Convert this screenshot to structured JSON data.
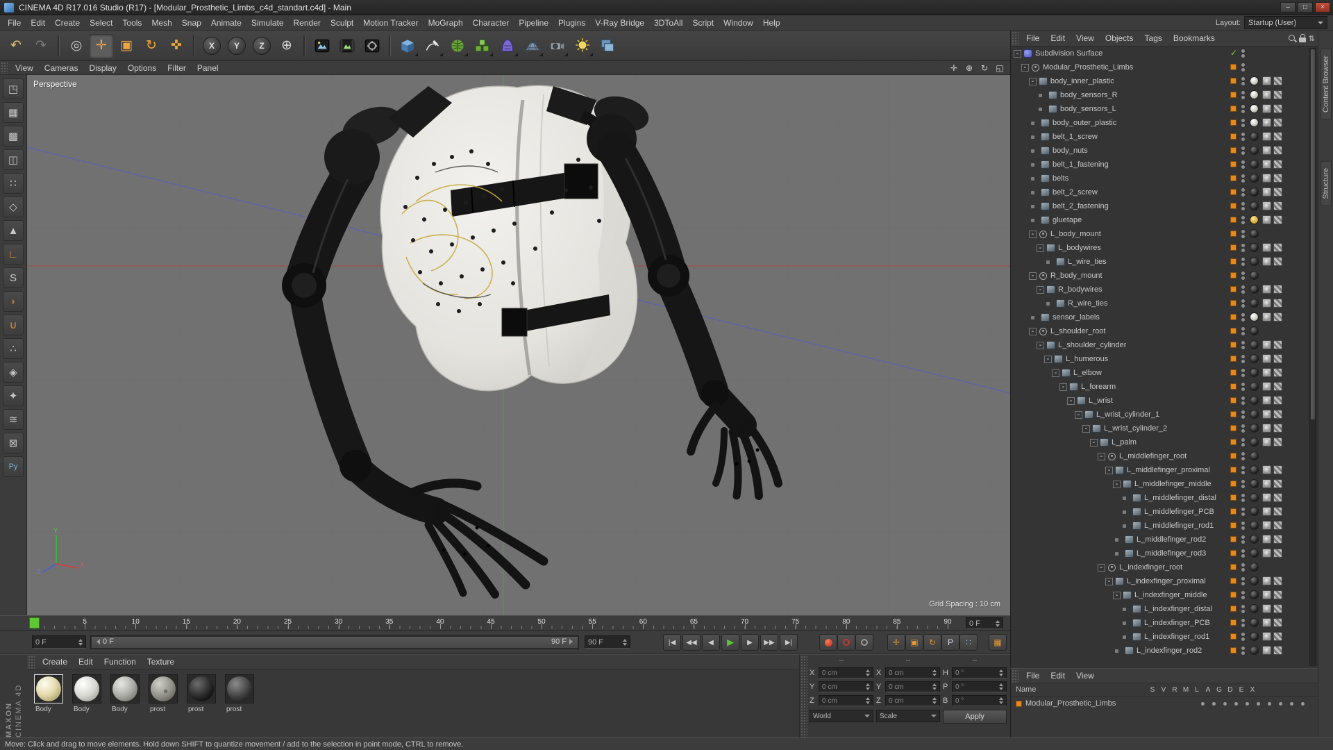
{
  "window": {
    "title": "CINEMA 4D R17.016 Studio (R17) - [Modular_Prosthetic_Limbs_c4d_standart.c4d] - Main",
    "minimize_label": "–",
    "maximize_label": "□",
    "close_label": "×"
  },
  "menubar": {
    "items": [
      "File",
      "Edit",
      "Create",
      "Select",
      "Tools",
      "Mesh",
      "Snap",
      "Animate",
      "Simulate",
      "Render",
      "Sculpt",
      "Motion Tracker",
      "MoGraph",
      "Character",
      "Pipeline",
      "Plugins",
      "V-Ray Bridge",
      "3DToAll",
      "Script",
      "Window",
      "Help"
    ],
    "layout_label": "Layout:",
    "layout_value": "Startup (User)"
  },
  "toolbar": {
    "buttons": [
      {
        "name": "undo-button",
        "kind": "glyph",
        "glyph": "↶",
        "color": "#e0be6a"
      },
      {
        "name": "redo-button",
        "kind": "glyph",
        "glyph": "↷",
        "color": "#7a7a7a"
      },
      {
        "kind": "sep"
      },
      {
        "name": "live-selection-button",
        "kind": "glyph",
        "glyph": "◎",
        "color": "#cccccc"
      },
      {
        "name": "move-tool-button",
        "kind": "glyph",
        "glyph": "✛",
        "color": "#f0a43c",
        "active": true
      },
      {
        "name": "scale-tool-button",
        "kind": "glyph",
        "glyph": "▣",
        "color": "#f0a43c"
      },
      {
        "name": "rotate-tool-button",
        "kind": "glyph",
        "glyph": "↻",
        "color": "#f0a43c"
      },
      {
        "name": "last-used-tool-button",
        "kind": "glyph",
        "glyph": "✜",
        "color": "#f0a43c"
      },
      {
        "kind": "sep"
      },
      {
        "name": "lock-x-axis-button",
        "kind": "circle",
        "letter": "X"
      },
      {
        "name": "lock-y-axis-button",
        "kind": "circle",
        "letter": "Y"
      },
      {
        "name": "lock-z-axis-button",
        "kind": "circle",
        "letter": "Z"
      },
      {
        "name": "coordinate-system-button",
        "kind": "glyph",
        "glyph": "⊕",
        "color": "#d8d8d8"
      },
      {
        "kind": "sep"
      },
      {
        "name": "render-view-button",
        "kind": "sym",
        "sym": "sym-render"
      },
      {
        "name": "render-to-picture-viewer-button",
        "kind": "sym",
        "sym": "sym-render-pv"
      },
      {
        "name": "edit-render-settings-button",
        "kind": "sym",
        "sym": "sym-render-settings"
      },
      {
        "kind": "sep"
      },
      {
        "name": "add-cube-button",
        "kind": "sym",
        "sym": "sym-cube",
        "flyout": true
      },
      {
        "name": "freehand-spline-button",
        "kind": "sym",
        "sym": "sym-pen",
        "flyout": true
      },
      {
        "name": "add-subdivision-surface-button",
        "kind": "sym",
        "sym": "sym-cage",
        "flyout": true
      },
      {
        "name": "add-mograph-cloner-button",
        "kind": "sym",
        "sym": "sym-array",
        "flyout": true
      },
      {
        "name": "add-deformer-button",
        "kind": "sym",
        "sym": "sym-deformer",
        "flyout": true
      },
      {
        "name": "add-floor-button",
        "kind": "sym",
        "sym": "sym-floor",
        "flyout": true
      },
      {
        "name": "add-camera-button",
        "kind": "sym",
        "sym": "sym-camera",
        "flyout": true
      },
      {
        "name": "add-light-button",
        "kind": "sym",
        "sym": "sym-light",
        "flyout": true
      },
      {
        "name": "interactive-render-region-button",
        "kind": "sym",
        "sym": "sym-irr"
      }
    ]
  },
  "left_palette": {
    "buttons": [
      {
        "name": "make-editable-button",
        "glyph": "◳",
        "color": "#c8c8c8"
      },
      {
        "name": "model-mode-button",
        "glyph": "▦",
        "color": "#c8c8c8"
      },
      {
        "name": "texture-mode-button",
        "glyph": "▩",
        "color": "#c8c8c8"
      },
      {
        "name": "workplane-mode-button",
        "glyph": "◫",
        "color": "#c8c8c8"
      },
      {
        "name": "points-mode-button",
        "glyph": "∷",
        "color": "#c8c8c8"
      },
      {
        "name": "edges-mode-button",
        "glyph": "◇",
        "color": "#c8c8c8"
      },
      {
        "name": "polygons-mode-button",
        "glyph": "▲",
        "color": "#c8c8c8"
      },
      {
        "name": "enable-axis-button",
        "glyph": "∟",
        "color": "#e8962e"
      },
      {
        "name": "viewport-solo-button",
        "glyph": "S",
        "color": "#c8c8c8"
      },
      {
        "name": "sculpt-brush-button",
        "glyph": "◗",
        "color": "#b07840"
      },
      {
        "name": "snap-toggle-button",
        "glyph": "∪",
        "color": "#e8962e"
      },
      {
        "name": "quantize-button",
        "glyph": "∴",
        "color": "#c8c8c8"
      },
      {
        "name": "workplane-lock-button",
        "glyph": "◈",
        "color": "#c8c8c8"
      },
      {
        "name": "tweak-mode-button",
        "glyph": "✦",
        "color": "#c8c8c8"
      },
      {
        "name": "isoline-editing-button",
        "glyph": "≋",
        "color": "#c8c8c8"
      },
      {
        "name": "lock-button",
        "glyph": "⊠",
        "color": "#c8c8c8"
      },
      {
        "name": "python-button",
        "glyph": "Py",
        "color": "#7ab0d4"
      }
    ]
  },
  "viewport": {
    "menus": [
      "View",
      "Cameras",
      "Display",
      "Options",
      "Filter",
      "Panel"
    ],
    "corner_icons": [
      {
        "name": "camera-move-icon",
        "glyph": "✛"
      },
      {
        "name": "camera-zoom-icon",
        "glyph": "⊕"
      },
      {
        "name": "camera-rotate-icon",
        "glyph": "↻"
      },
      {
        "name": "toggle-view-icon",
        "glyph": "◱"
      }
    ],
    "view_label": "Perspective",
    "grid_spacing_label": "Grid Spacing : 10 cm",
    "axis_labels": [
      "X",
      "Y",
      "Z"
    ]
  },
  "timeline": {
    "frame_labels": [
      "5",
      "10",
      "15",
      "20",
      "25",
      "30",
      "35",
      "40",
      "45",
      "50",
      "55",
      "60",
      "65",
      "70",
      "75",
      "80",
      "85",
      "90"
    ],
    "frame_start": 0,
    "frame_end": 90,
    "current_frame": 0,
    "ruler_field": "0 F",
    "current_frame_field": "0 F",
    "range_start_label": "0 F",
    "range_end_label": "90 F",
    "end_frame_field": "90 F",
    "transport": [
      {
        "name": "go-to-start-button",
        "label": "|◀"
      },
      {
        "name": "go-to-previous-key-button",
        "label": "◀◀"
      },
      {
        "name": "go-to-previous-frame-button",
        "label": "◀"
      },
      {
        "name": "play-forwards-button",
        "label": "▶",
        "accent": true
      },
      {
        "name": "go-to-next-frame-button",
        "label": "▶"
      },
      {
        "name": "go-to-next-key-button",
        "label": "▶▶"
      },
      {
        "name": "go-to-end-button",
        "label": "▶|"
      }
    ],
    "record_buttons": [
      {
        "name": "record-keyframe-button",
        "kind": "red-dot"
      },
      {
        "name": "autokeying-button",
        "kind": "red-ring"
      },
      {
        "name": "keyframe-selection-button",
        "kind": "gray-dot"
      }
    ],
    "record_toggles": [
      {
        "name": "record-position-toggle",
        "glyph": "✛",
        "color": "#e8962e"
      },
      {
        "name": "record-scale-toggle",
        "glyph": "▣",
        "color": "#e8962e"
      },
      {
        "name": "record-rotation-toggle",
        "glyph": "↻",
        "color": "#e8962e"
      },
      {
        "name": "record-parameter-toggle",
        "glyph": "P",
        "color": "#d8dce8"
      },
      {
        "name": "point-level-animation-toggle",
        "glyph": "∷",
        "color": "#9fb8d8"
      }
    ],
    "options_glyph": "▦"
  },
  "materials_panel": {
    "menus": [
      "Create",
      "Edit",
      "Function",
      "Texture"
    ],
    "materials": [
      {
        "name": "Body",
        "look": "ivory",
        "selected": true
      },
      {
        "name": "Body",
        "look": "white"
      },
      {
        "name": "Body",
        "look": "gray"
      },
      {
        "name": "prost",
        "look": "speckled"
      },
      {
        "name": "prost",
        "look": "black"
      },
      {
        "name": "prost",
        "look": "darkgray"
      }
    ]
  },
  "coordinates_panel": {
    "headers": [
      "--",
      "--",
      "--"
    ],
    "columns": [
      {
        "name": "position",
        "rows": [
          [
            "X",
            "0 cm"
          ],
          [
            "Y",
            "0 cm"
          ],
          [
            "Z",
            "0 cm"
          ]
        ],
        "footer_kind": "dropdown",
        "footer_label": "World"
      },
      {
        "name": "size",
        "rows": [
          [
            "X",
            "0 cm"
          ],
          [
            "Y",
            "0 cm"
          ],
          [
            "Z",
            "0 cm"
          ]
        ],
        "footer_kind": "dropdown",
        "footer_label": "Scale"
      },
      {
        "name": "rotation",
        "rows": [
          [
            "H",
            "0 °"
          ],
          [
            "P",
            "0 °"
          ],
          [
            "B",
            "0 °"
          ]
        ],
        "footer_kind": "button",
        "footer_label": "Apply"
      }
    ]
  },
  "object_manager": {
    "menus": [
      "File",
      "Edit",
      "View",
      "Objects",
      "Tags",
      "Bookmarks"
    ],
    "items": [
      {
        "n": "Subdivision Surface",
        "l": 0,
        "e": 1,
        "i": "sds",
        "m": null,
        "check": true
      },
      {
        "n": "Modular_Prosthetic_Limbs",
        "l": 1,
        "e": 1,
        "i": "null",
        "m": null
      },
      {
        "n": "body_inner_plastic",
        "l": 2,
        "e": 1,
        "i": "mesh",
        "m": "w"
      },
      {
        "n": "body_sensors_R",
        "l": 3,
        "i": "mesh",
        "m": "w"
      },
      {
        "n": "body_sensors_L",
        "l": 3,
        "i": "mesh",
        "m": "w"
      },
      {
        "n": "body_outer_plastic",
        "l": 2,
        "i": "mesh",
        "m": "w"
      },
      {
        "n": "belt_1_screw",
        "l": 2,
        "i": "mesh",
        "m": "d"
      },
      {
        "n": "body_nuts",
        "l": 2,
        "i": "mesh",
        "m": "d"
      },
      {
        "n": "belt_1_fastening",
        "l": 2,
        "i": "mesh",
        "m": "d"
      },
      {
        "n": "belts",
        "l": 2,
        "i": "mesh",
        "m": "d"
      },
      {
        "n": "belt_2_screw",
        "l": 2,
        "i": "mesh",
        "m": "d"
      },
      {
        "n": "belt_2_fastening",
        "l": 2,
        "i": "mesh",
        "m": "d"
      },
      {
        "n": "gluetape",
        "l": 2,
        "i": "mesh",
        "m": "y"
      },
      {
        "n": "L_body_mount",
        "l": 2,
        "e": 1,
        "i": "null",
        "m": "d"
      },
      {
        "n": "L_bodywires",
        "l": 3,
        "e": 1,
        "i": "mesh",
        "m": "d"
      },
      {
        "n": "L_wire_ties",
        "l": 4,
        "i": "mesh",
        "m": "d"
      },
      {
        "n": "R_body_mount",
        "l": 2,
        "e": 1,
        "i": "null",
        "m": "d"
      },
      {
        "n": "R_bodywires",
        "l": 3,
        "e": 1,
        "i": "mesh",
        "m": "d"
      },
      {
        "n": "R_wire_ties",
        "l": 4,
        "i": "mesh",
        "m": "d"
      },
      {
        "n": "sensor_labels",
        "l": 2,
        "i": "mesh",
        "m": "w"
      },
      {
        "n": "L_shoulder_root",
        "l": 2,
        "e": 1,
        "i": "null",
        "m": "d"
      },
      {
        "n": "L_shoulder_cylinder",
        "l": 3,
        "e": 1,
        "i": "mesh",
        "m": "d"
      },
      {
        "n": "L_humerous",
        "l": 4,
        "e": 1,
        "i": "mesh",
        "m": "d"
      },
      {
        "n": "L_elbow",
        "l": 5,
        "e": 1,
        "i": "mesh",
        "m": "d"
      },
      {
        "n": "L_forearm",
        "l": 6,
        "e": 1,
        "i": "mesh",
        "m": "d"
      },
      {
        "n": "L_wrist",
        "l": 7,
        "e": 1,
        "i": "mesh",
        "m": "d"
      },
      {
        "n": "L_wrist_cylinder_1",
        "l": 8,
        "e": 1,
        "i": "mesh",
        "m": "d"
      },
      {
        "n": "L_wrist_cylinder_2",
        "l": 9,
        "e": 1,
        "i": "mesh",
        "m": "d"
      },
      {
        "n": "L_palm",
        "l": 10,
        "e": 1,
        "i": "mesh",
        "m": "d"
      },
      {
        "n": "L_middlefinger_root",
        "l": 11,
        "e": 1,
        "i": "null",
        "m": "d"
      },
      {
        "n": "L_middlefinger_proximal",
        "l": 12,
        "e": 1,
        "i": "mesh",
        "m": "d"
      },
      {
        "n": "L_middlefinger_middle",
        "l": 13,
        "e": 1,
        "i": "mesh",
        "m": "d"
      },
      {
        "n": "L_middlefinger_distal",
        "l": 14,
        "i": "mesh",
        "m": "d"
      },
      {
        "n": "L_middlefinger_PCB",
        "l": 14,
        "i": "mesh",
        "m": "d"
      },
      {
        "n": "L_middlefinger_rod1",
        "l": 14,
        "i": "mesh",
        "m": "d"
      },
      {
        "n": "L_middlefinger_rod2",
        "l": 13,
        "i": "mesh",
        "m": "d"
      },
      {
        "n": "L_middlefinger_rod3",
        "l": 13,
        "i": "mesh",
        "m": "d"
      },
      {
        "n": "L_indexfinger_root",
        "l": 11,
        "e": 1,
        "i": "null",
        "m": "d"
      },
      {
        "n": "L_indexfinger_proximal",
        "l": 12,
        "e": 1,
        "i": "mesh",
        "m": "d"
      },
      {
        "n": "L_indexfinger_middle",
        "l": 13,
        "e": 1,
        "i": "mesh",
        "m": "d"
      },
      {
        "n": "L_indexfinger_distal",
        "l": 14,
        "i": "mesh",
        "m": "d"
      },
      {
        "n": "L_indexfinger_PCB",
        "l": 14,
        "i": "mesh",
        "m": "d"
      },
      {
        "n": "L_indexfinger_rod1",
        "l": 14,
        "i": "mesh",
        "m": "d"
      },
      {
        "n": "L_indexfinger_rod2",
        "l": 13,
        "i": "mesh",
        "m": "d"
      }
    ]
  },
  "layer_manager": {
    "menus": [
      "File",
      "Edit",
      "View"
    ],
    "name_header": "Name",
    "columns": [
      "S",
      "V",
      "R",
      "M",
      "L",
      "A",
      "G",
      "D",
      "E",
      "X"
    ],
    "layer_name": "Modular_Prosthetic_Limbs",
    "layer_color": "#e8891c"
  },
  "right_dock": {
    "tabs": [
      "Content Browser",
      "Structure"
    ]
  },
  "branding": {
    "line1": "MAXON",
    "line2": "CINEMA 4D"
  },
  "status_bar": {
    "text": "Move: Click and drag to move elements. Hold down SHIFT to quantize movement / add to the selection in point mode, CTRL to remove."
  }
}
